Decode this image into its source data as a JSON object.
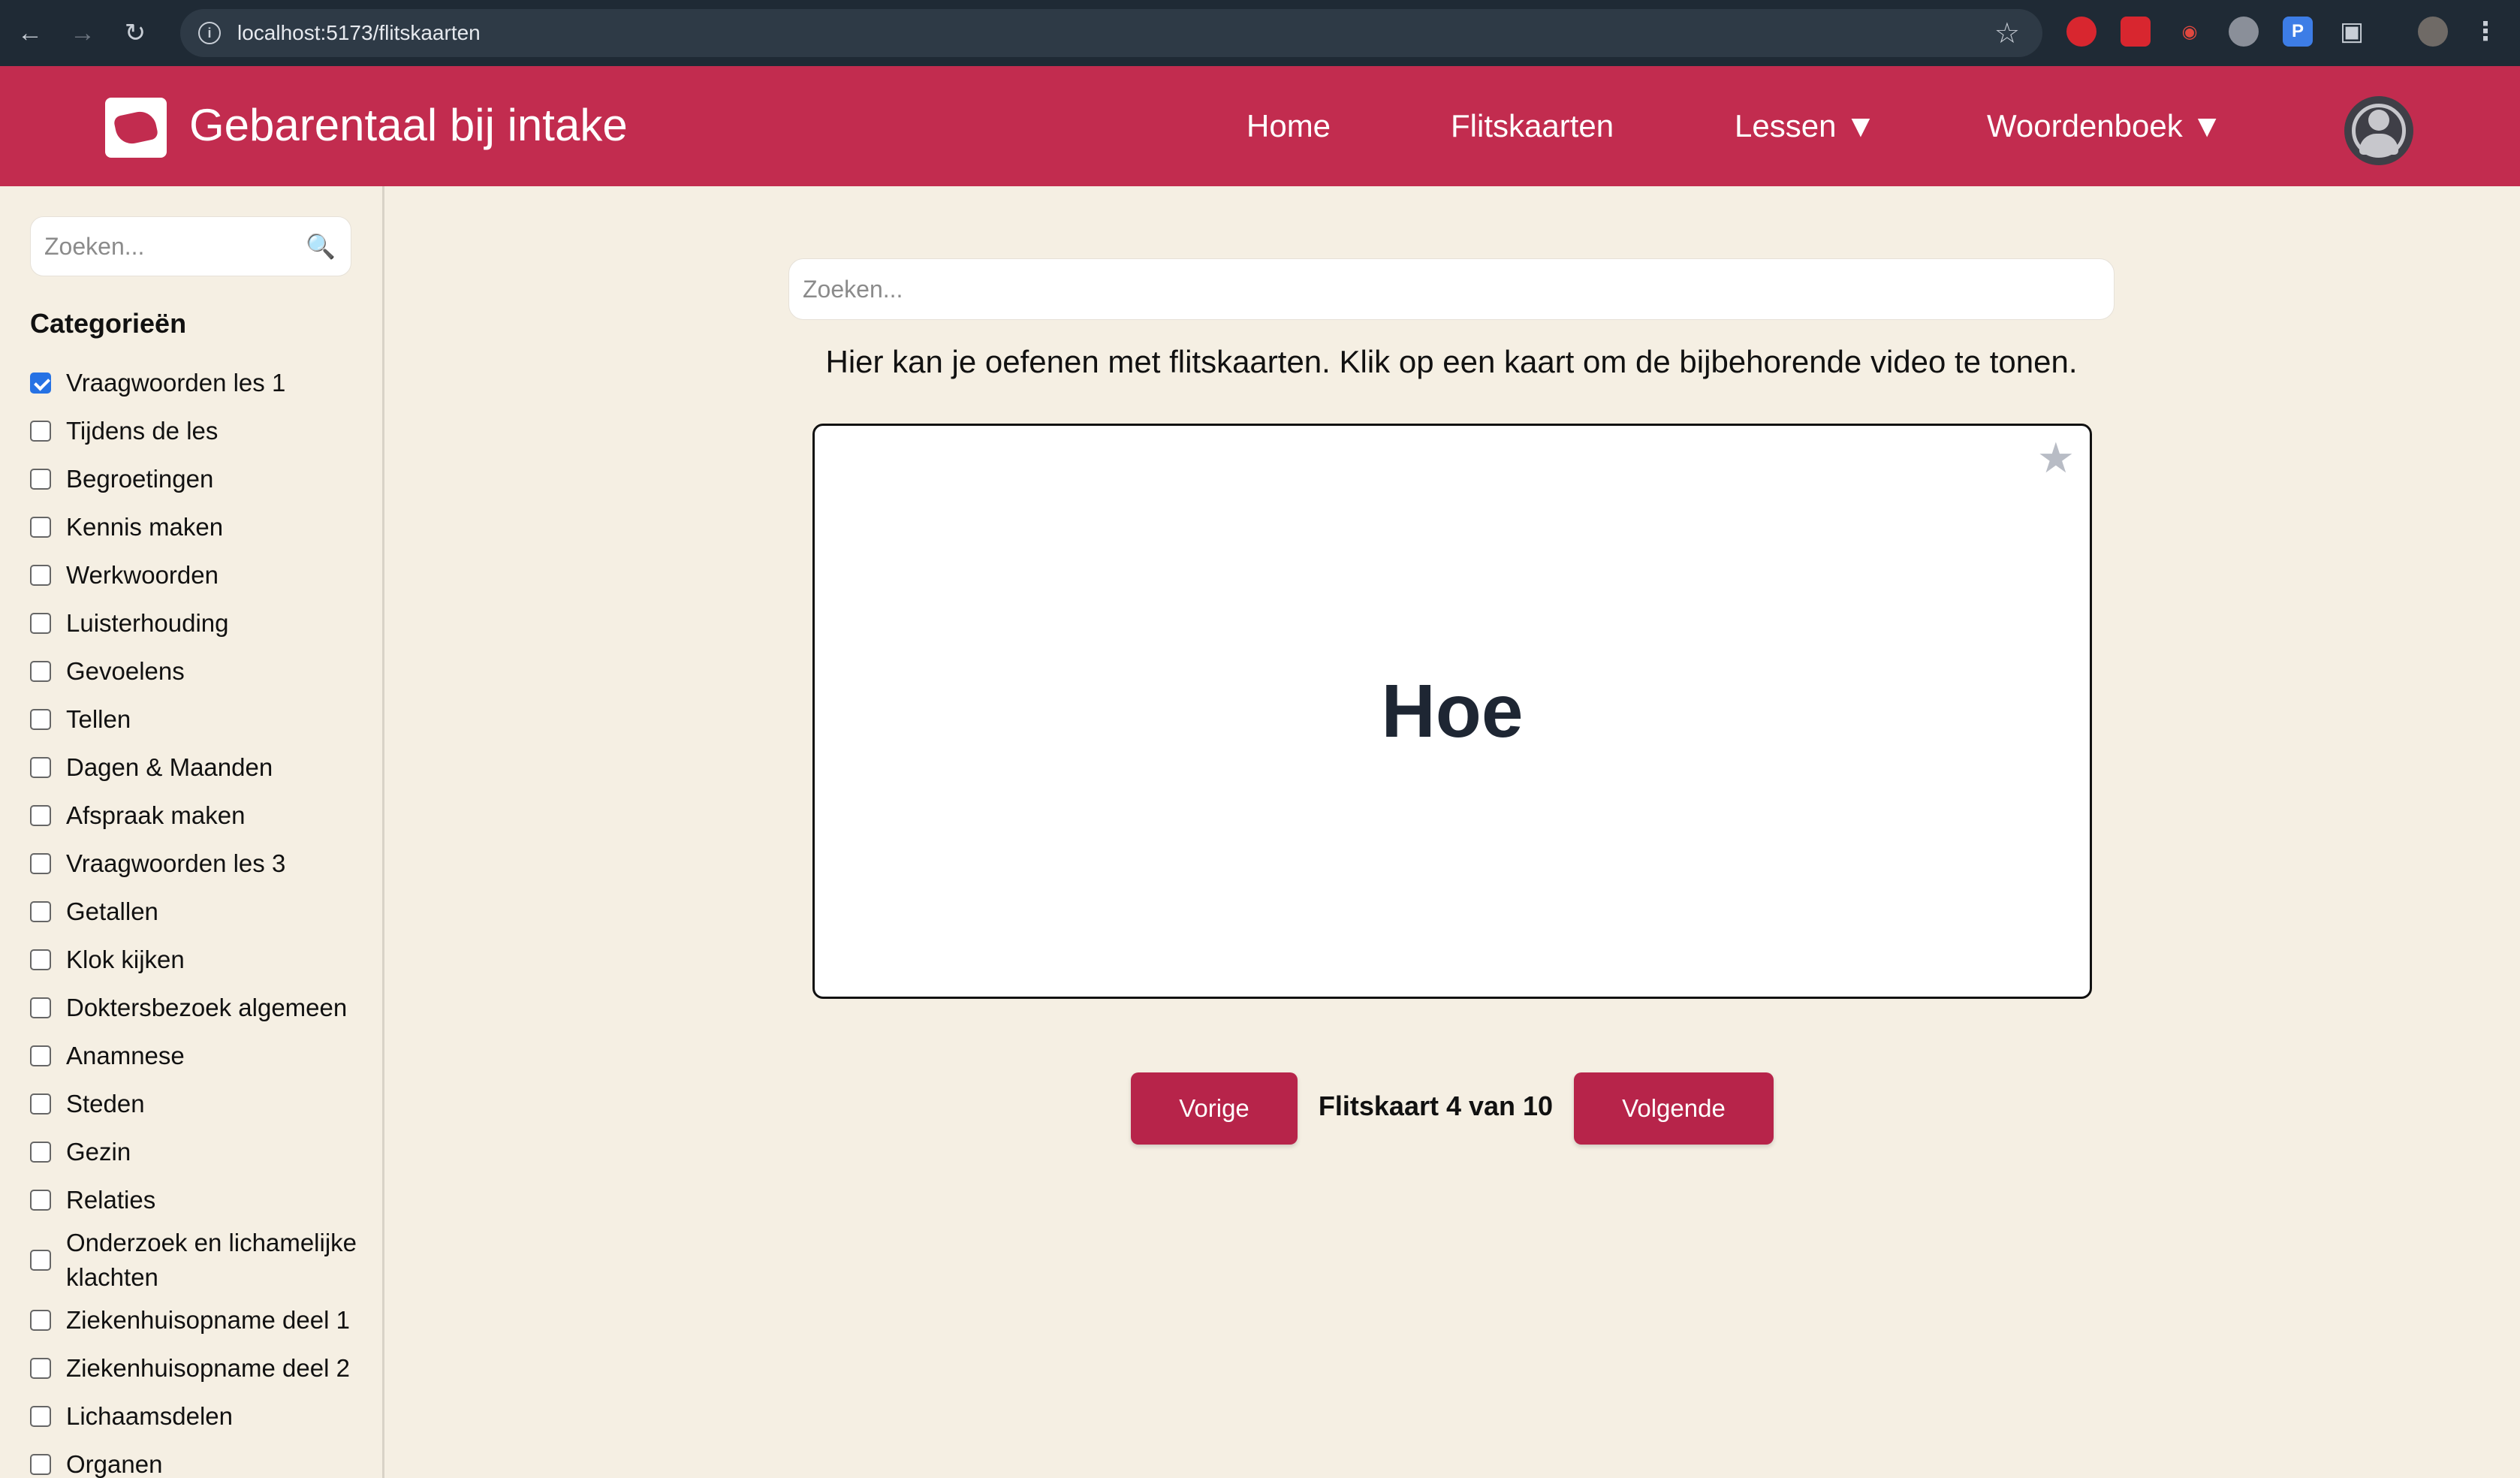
{
  "browser": {
    "url": "localhost:5173/flitskaarten"
  },
  "header": {
    "title": "Gebarentaal bij intake",
    "nav": [
      {
        "label": "Home"
      },
      {
        "label": "Flitskaarten"
      },
      {
        "label": "Lessen ▼"
      },
      {
        "label": "Woordenboek ▼"
      }
    ]
  },
  "sidebar": {
    "search_placeholder": "Zoeken...",
    "categories_title": "Categorieën",
    "categories": [
      {
        "label": "Vraagwoorden les 1",
        "checked": true
      },
      {
        "label": "Tijdens de les",
        "checked": false
      },
      {
        "label": "Begroetingen",
        "checked": false
      },
      {
        "label": "Kennis maken",
        "checked": false
      },
      {
        "label": "Werkwoorden",
        "checked": false
      },
      {
        "label": "Luisterhouding",
        "checked": false
      },
      {
        "label": "Gevoelens",
        "checked": false
      },
      {
        "label": "Tellen",
        "checked": false
      },
      {
        "label": "Dagen & Maanden",
        "checked": false
      },
      {
        "label": "Afspraak maken",
        "checked": false
      },
      {
        "label": "Vraagwoorden les 3",
        "checked": false
      },
      {
        "label": "Getallen",
        "checked": false
      },
      {
        "label": "Klok kijken",
        "checked": false
      },
      {
        "label": "Doktersbezoek algemeen",
        "checked": false
      },
      {
        "label": "Anamnese",
        "checked": false
      },
      {
        "label": "Steden",
        "checked": false
      },
      {
        "label": "Gezin",
        "checked": false
      },
      {
        "label": "Relaties",
        "checked": false
      },
      {
        "label": "Onderzoek en lichamelijke klachten",
        "checked": false
      },
      {
        "label": "Ziekenhuisopname deel 1",
        "checked": false
      },
      {
        "label": "Ziekenhuisopname deel 2",
        "checked": false
      },
      {
        "label": "Lichaamsdelen",
        "checked": false
      },
      {
        "label": "Organen",
        "checked": false
      }
    ]
  },
  "main": {
    "search_placeholder": "Zoeken...",
    "instructions": "Hier kan je oefenen met flitskaarten. Klik op een kaart om de bijbehorende video te tonen.",
    "card_word": "Hoe",
    "prev_label": "Vorige",
    "next_label": "Volgende",
    "counter": "Flitskaart 4 van 10"
  },
  "colors": {
    "brand": "#c22c4f",
    "button": "#b7244a",
    "background": "#f5efe3",
    "checkbox_checked": "#2672e4"
  }
}
